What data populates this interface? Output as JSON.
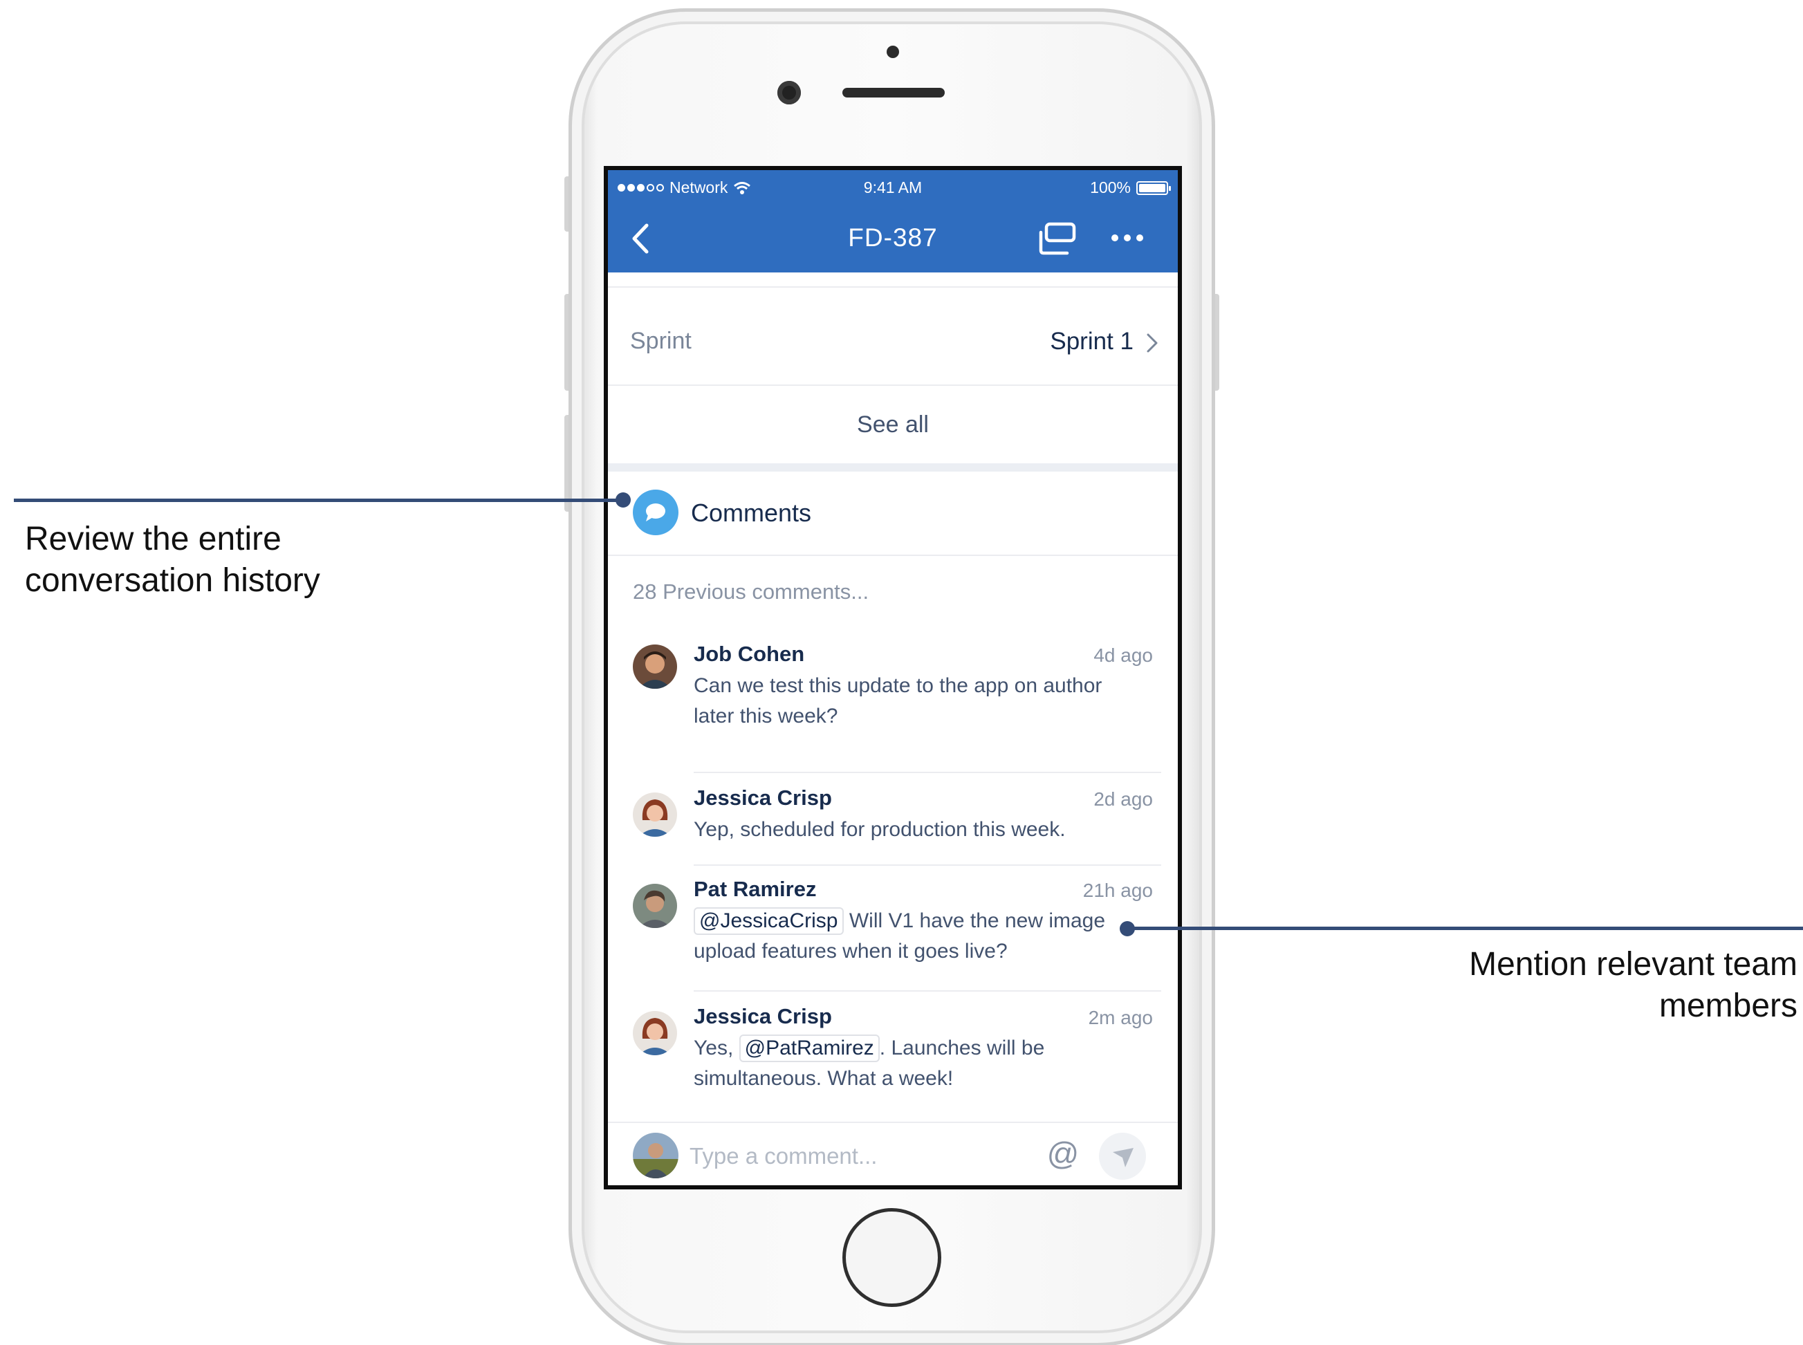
{
  "status_bar": {
    "network_label": "Network",
    "time": "9:41 AM",
    "battery_label": "100%"
  },
  "nav": {
    "title": "FD-387",
    "icons": [
      "back-chevron-icon",
      "cards-icon",
      "more-dots-icon"
    ]
  },
  "sprint_row": {
    "label": "Sprint",
    "value": "Sprint 1"
  },
  "see_all_label": "See all",
  "comments": {
    "title": "Comments",
    "previous_link": "28 Previous comments...",
    "items": [
      {
        "author": "Job Cohen",
        "time": "4d ago",
        "line1": "Can we test this update to the app on author",
        "line2": "later this week?"
      },
      {
        "author": "Jessica Crisp",
        "time": "2d ago",
        "line1": "Yep, scheduled for production this week."
      },
      {
        "author": "Pat Ramirez",
        "time": "21h ago",
        "mention": "@JessicaCrisp",
        "line1_after": "Will V1 have the new image",
        "line2": "upload features when it goes live?"
      },
      {
        "author": "Jessica Crisp",
        "time": "2m ago",
        "line1_before": "Yes,",
        "mention": "@PatRamirez",
        "line1_after": ". Launches will be",
        "line2": "simultaneous. What a week!"
      }
    ]
  },
  "composer": {
    "placeholder": "Type a comment...",
    "at_label": "@"
  },
  "callouts": {
    "left_line1": "Review the entire",
    "left_line2": "conversation history",
    "right_line1": "Mention relevant team",
    "right_line2": "members"
  },
  "colors": {
    "brand_blue": "#2f6dbf",
    "comments_icon": "#4aa8e8",
    "callout_line": "#344c77"
  }
}
